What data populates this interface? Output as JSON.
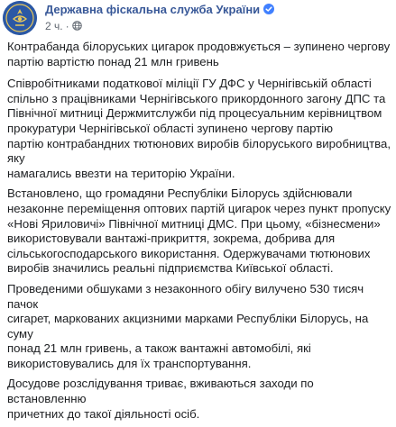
{
  "header": {
    "page_name": "Державна фіскальна служба України",
    "verified_icon": "verified-badge-icon",
    "time": "2 ч.",
    "separator": "·",
    "audience_icon": "globe-icon",
    "avatar_icon": "tax-service-emblem-icon"
  },
  "post": {
    "title": "Контрабанда білоруських цигарок продовжується – зупинено чергову\nпартію вартістю понад 21 млн гривень",
    "p1": "Співробітниками податкової міліції ГУ ДФС у Чернігівській області\nспільно з працівниками Чернігівського прикордонного загону ДПС та\nПівнічної митниці Держмитслужби під процесуальним керівництвом\nпрокуратури Чернігівської області зупинено чергову партію\nпартію контрабандних тютюнових виробів білоруського виробництва, яку\nнамагались ввезти на територію України.",
    "p2": "Встановлено, що громадяни Республіки Білорусь здійснювали\nнезаконне переміщення оптових партій цигарок через пункт пропуску\n«Нові Яриловичі» Північної митниці ДМС. При цьому, «бізнесмени»\nвикористовували вантажі-прикриття, зокрема, добрива для\nсільськогосподарського використання. Одержувачами тютюнових\nвиробів значились реальні підприємства Київської області.",
    "p3": "Проведеними обшуками з незаконного обігу вилучено 530 тисяч пачок\nсигарет, маркованих акцизними марками Республіки Білорусь, на суму\nпонад 21 млн гривень, а також вантажні автомобілі, які\nвикористовувались для їх транспортування.",
    "p4": "Досудове розслідування триває, вживаються заходи по встановленню\nпричетних до такої діяльності осіб."
  },
  "colors": {
    "page_name": "#385898",
    "meta": "#606770",
    "text": "#1c1e21",
    "avatar_bg": "#2b58a5",
    "verified": "#4080ff"
  }
}
